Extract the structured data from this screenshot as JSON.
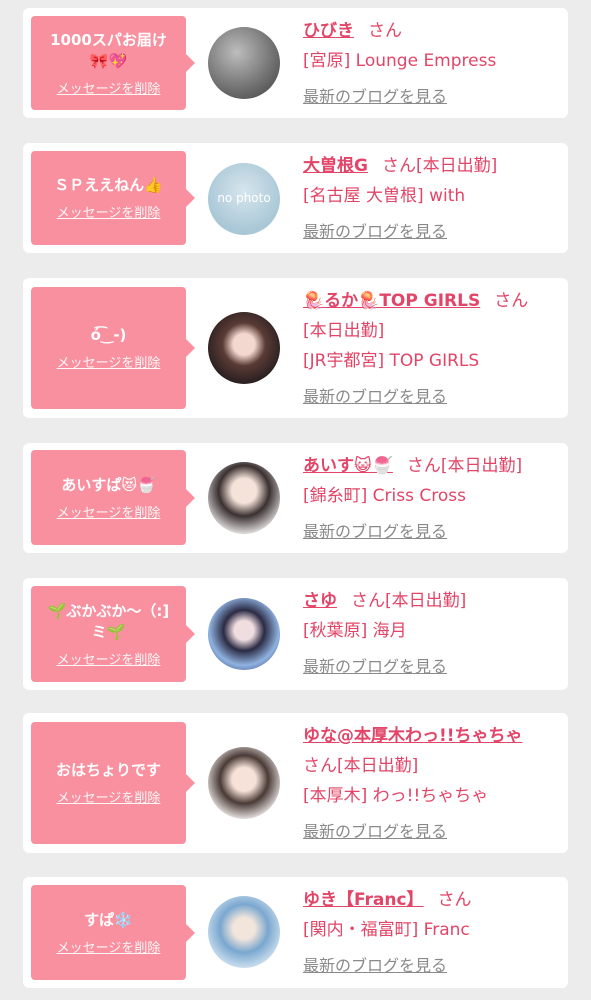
{
  "delete_label": "メッセージを削除",
  "san_label": "さん",
  "blog_label": "最新のブログを見る",
  "colors": {
    "accent": "#e24567",
    "bubble": "#f9909f",
    "background": "#ececec"
  },
  "items": [
    {
      "message": "1000スパお届け",
      "message2": "🎀💖",
      "name": "ひびき",
      "name_suffix": "",
      "status": "",
      "area": "[宮原] Lounge Empress",
      "avatar_icon": "photo-dark-gray"
    },
    {
      "message": "ＳＰええねん👍",
      "message2": "",
      "name": "大曽根G",
      "status": "[本日出勤]",
      "area": "[名古屋 大曽根] with",
      "avatar_icon": "no-photo",
      "avatar_text": "no photo"
    },
    {
      "message": "ó͡‿-)",
      "message2": "",
      "name": "🪼るか🪼TOP GIRLS",
      "status": "[本日出勤]",
      "area": "[JR宇都宮] TOP GIRLS",
      "avatar_icon": "photo-woman"
    },
    {
      "message": "あいすぱ😻🍧",
      "message2": "",
      "name": "あいす😺🍧",
      "status": "[本日出勤]",
      "area": "[錦糸町] Criss Cross",
      "avatar_icon": "photo-woman-emoji"
    },
    {
      "message": "🌱ぶかぶか〜（:]",
      "message2": "ミ🌱",
      "name": "さゆ",
      "status": "[本日出勤]",
      "area": "[秋葉原] 海月",
      "avatar_icon": "photo-woman-blue"
    },
    {
      "message": "おはちょりです",
      "message2": "",
      "name": "ゆな@本厚木わっ!!ちゃちゃ",
      "status": "[本日出勤]",
      "area": "[本厚木] わっ!!ちゃちゃ",
      "avatar_icon": "photo-woman"
    },
    {
      "message": "すぱ❄️",
      "message2": "",
      "name": "ゆき【Franc】",
      "status": "",
      "area": "[関内・福富町] Franc",
      "avatar_icon": "photo-woman-light"
    }
  ]
}
